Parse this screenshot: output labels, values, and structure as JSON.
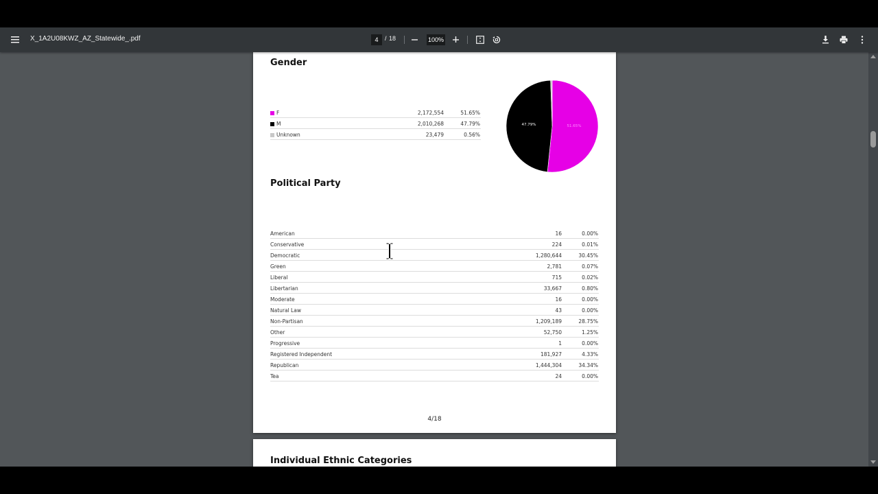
{
  "toolbar": {
    "title": "X_1A2U08KWZ_AZ_Statewide_.pdf",
    "current_page": "4",
    "page_separator": "/",
    "total_pages": "18",
    "zoom": "100%"
  },
  "gender": {
    "heading": "Gender",
    "rows": [
      {
        "label": "F",
        "count": "2,172,554",
        "percent": "51.65%",
        "color": "#e600e6"
      },
      {
        "label": "M",
        "count": "2,010,268",
        "percent": "47.79%",
        "color": "#000000"
      },
      {
        "label": "Unknown",
        "count": "23,479",
        "percent": "0.56%",
        "color": "#c8c8c8"
      }
    ],
    "pie_labels": {
      "m": "47.79%",
      "f": "51.65%"
    }
  },
  "chart_data": {
    "type": "pie",
    "categories": [
      "F",
      "M",
      "Unknown"
    ],
    "values": [
      51.65,
      47.79,
      0.56
    ],
    "colors": [
      "#e600e6",
      "#000000",
      "#c8c8c8"
    ]
  },
  "party": {
    "heading": "Political Party",
    "rows": [
      {
        "label": "American",
        "count": "16",
        "percent": "0.00%"
      },
      {
        "label": "Conservative",
        "count": "224",
        "percent": "0.01%"
      },
      {
        "label": "Democratic",
        "count": "1,280,644",
        "percent": "30.45%"
      },
      {
        "label": "Green",
        "count": "2,781",
        "percent": "0.07%"
      },
      {
        "label": "Liberal",
        "count": "715",
        "percent": "0.02%"
      },
      {
        "label": "Libertarian",
        "count": "33,667",
        "percent": "0.80%"
      },
      {
        "label": "Moderate",
        "count": "16",
        "percent": "0.00%"
      },
      {
        "label": "Natural Law",
        "count": "43",
        "percent": "0.00%"
      },
      {
        "label": "Non-Partisan",
        "count": "1,209,189",
        "percent": "28.75%"
      },
      {
        "label": "Other",
        "count": "52,750",
        "percent": "1.25%"
      },
      {
        "label": "Progressive",
        "count": "1",
        "percent": "0.00%"
      },
      {
        "label": "Registered Independent",
        "count": "181,927",
        "percent": "4.33%"
      },
      {
        "label": "Republican",
        "count": "1,444,304",
        "percent": "34.34%"
      },
      {
        "label": "Tea",
        "count": "24",
        "percent": "0.00%"
      }
    ]
  },
  "page_footer": "4/18",
  "next_page": {
    "heading": "Individual Ethnic Categories"
  }
}
